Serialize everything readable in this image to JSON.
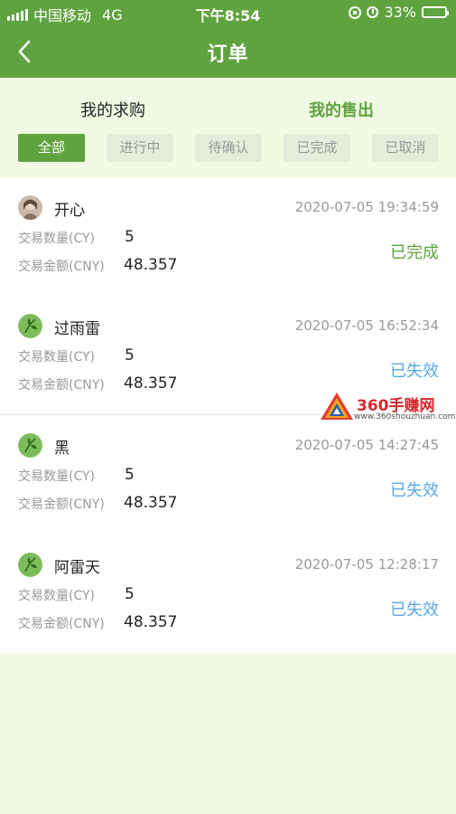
{
  "status_bar": {
    "carrier": "中国移动",
    "network": "4G",
    "time": "下午8:54",
    "battery": "33%",
    "battery_level": 0.33
  },
  "nav": {
    "title": "订单"
  },
  "main_tabs": [
    {
      "label": "我的求购",
      "active": false
    },
    {
      "label": "我的售出",
      "active": true
    }
  ],
  "filters": [
    {
      "label": "全部",
      "active": true
    },
    {
      "label": "进行中",
      "active": false
    },
    {
      "label": "待确认",
      "active": false
    },
    {
      "label": "已完成",
      "active": false
    },
    {
      "label": "已取消",
      "active": false
    }
  ],
  "orders": [
    {
      "name": "开心",
      "time": "2020-07-05 19:34:59",
      "qty_label": "交易数量(CY)",
      "qty": "5",
      "amount_label": "交易金额(CNY)",
      "amount": "48.357",
      "status": "已完成",
      "avatar": "photo"
    },
    {
      "name": "过雨雷",
      "time": "2020-07-05 16:52:34",
      "qty_label": "交易数量(CY)",
      "qty": "5",
      "amount_label": "交易金额(CNY)",
      "amount": "48.357",
      "status": "已失效",
      "avatar": "leaf"
    },
    {
      "name": "黑",
      "time": "2020-07-05 14:27:45",
      "qty_label": "交易数量(CY)",
      "qty": "5",
      "amount_label": "交易金额(CNY)",
      "amount": "48.357",
      "status": "已失效",
      "avatar": "leaf"
    },
    {
      "name": "阿雷天",
      "time": "2020-07-05 12:28:17",
      "qty_label": "交易数量(CY)",
      "qty": "5",
      "amount_label": "交易金额(CNY)",
      "amount": "48.357",
      "status": "已失效",
      "avatar": "leaf"
    }
  ],
  "watermark": {
    "title": "360手赚网",
    "url": "www.360shouzhuan.com"
  },
  "colors": {
    "brand_green": "#5fa33f",
    "status_expired_blue": "#5aa9e6",
    "background": "#f1fbe3"
  }
}
